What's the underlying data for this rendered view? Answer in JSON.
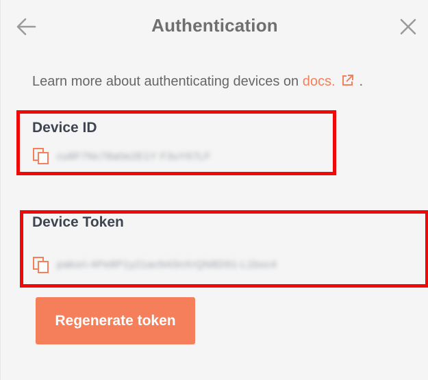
{
  "header": {
    "title": "Authentication",
    "back_icon": "arrow-left-icon",
    "close_icon": "close-icon"
  },
  "intro": {
    "text": "Learn more about authenticating devices on ",
    "link_text": "docs.",
    "link_icon": "external-link-icon",
    "trailing": "."
  },
  "device_id": {
    "label": "Device ID",
    "copy_icon": "copy-icon",
    "value": "cu8F7Nc78a0e2E1Y F3uY67LF"
  },
  "device_token": {
    "label": "Device Token",
    "copy_icon": "copy-icon",
    "value": "pakori-4Pe8P1y21acN43nXrQN8D91-L1boc4"
  },
  "actions": {
    "regenerate_label": "Regenerate token"
  },
  "colors": {
    "accent": "#f47f5a",
    "highlight": "#ef0a0a",
    "background": "#f5f5f5",
    "label": "#3f4550"
  }
}
